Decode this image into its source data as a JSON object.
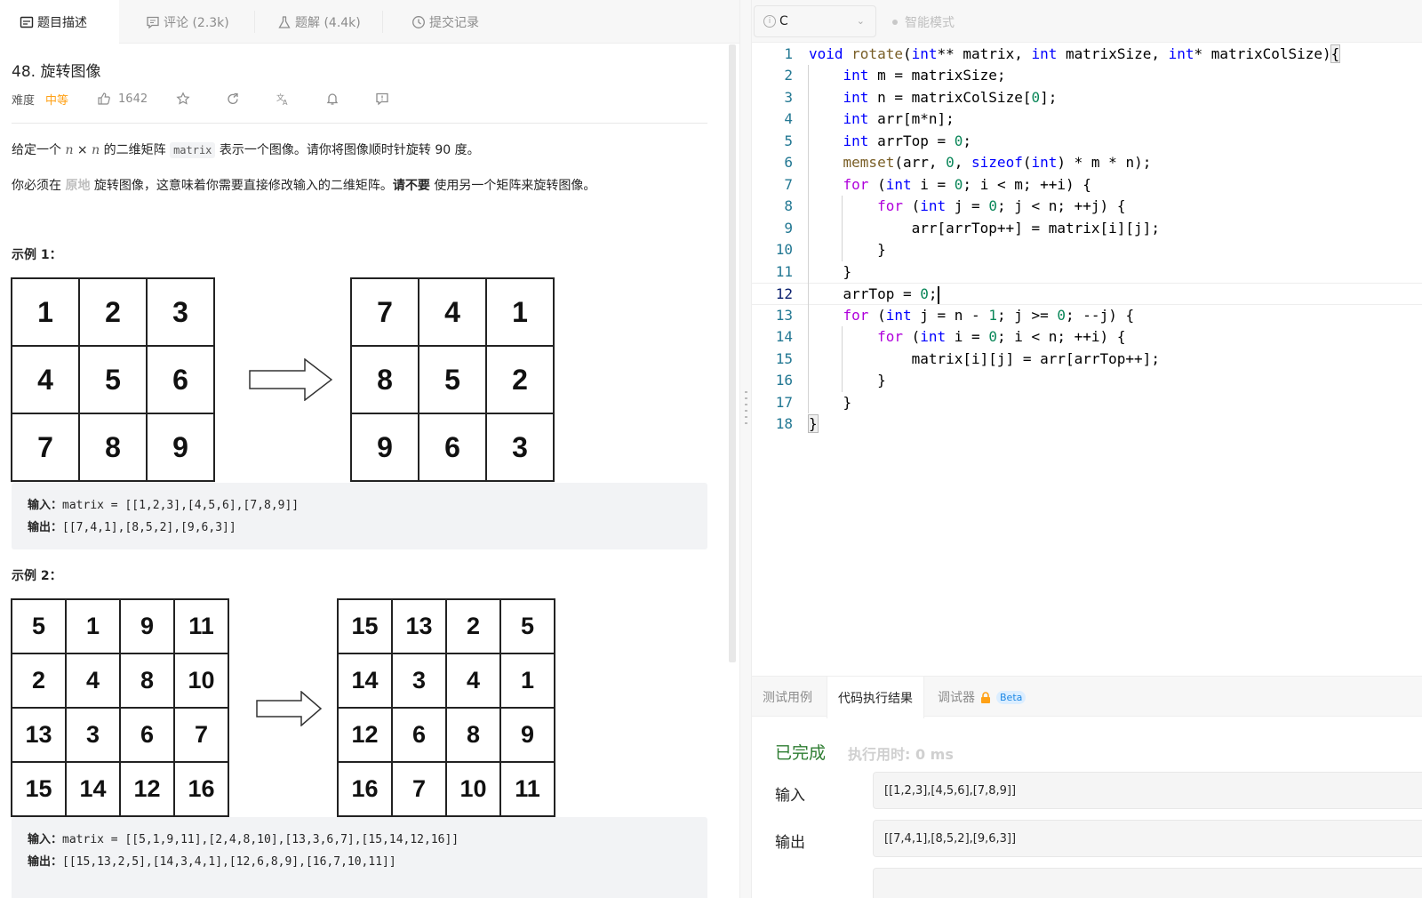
{
  "left_tabs": [
    {
      "label": "题目描述",
      "icon": "description-icon",
      "active": true
    },
    {
      "label": "评论 (2.3k)",
      "icon": "comment-icon",
      "active": false
    },
    {
      "label": "题解 (4.4k)",
      "icon": "flask-icon",
      "active": false
    },
    {
      "label": "提交记录",
      "icon": "clock-icon",
      "active": false
    }
  ],
  "problem": {
    "title": "48. 旋转图像",
    "difficulty_label": "难度",
    "difficulty_value": "中等",
    "likes": "1642",
    "desc1_a": "给定一个 ",
    "desc1_n1": "n",
    "desc1_x": " × ",
    "desc1_n2": "n",
    "desc1_b": " 的二维矩阵 ",
    "desc1_code": "matrix",
    "desc1_c": " 表示一个图像。请你将图像顺时针旋转 90 度。",
    "desc2_a": "你必须在 ",
    "desc2_inplace": "原地",
    "desc2_b": " 旋转图像，这意味着你需要直接修改输入的二维矩阵。",
    "desc2_bold": "请不要",
    "desc2_c": " 使用另一个矩阵来旋转图像。"
  },
  "examples": [
    {
      "heading": "示例 1：",
      "input_matrix": [
        [
          1,
          2,
          3
        ],
        [
          4,
          5,
          6
        ],
        [
          7,
          8,
          9
        ]
      ],
      "output_matrix": [
        [
          7,
          4,
          1
        ],
        [
          8,
          5,
          2
        ],
        [
          9,
          6,
          3
        ]
      ],
      "input_label": "输入：",
      "input_text": "matrix = [[1,2,3],[4,5,6],[7,8,9]]",
      "output_label": "输出：",
      "output_text": "[[7,4,1],[8,5,2],[9,6,3]]"
    },
    {
      "heading": "示例 2：",
      "input_matrix": [
        [
          5,
          1,
          9,
          11
        ],
        [
          2,
          4,
          8,
          10
        ],
        [
          13,
          3,
          6,
          7
        ],
        [
          15,
          14,
          12,
          16
        ]
      ],
      "output_matrix": [
        [
          15,
          13,
          2,
          5
        ],
        [
          14,
          3,
          4,
          1
        ],
        [
          12,
          6,
          8,
          9
        ],
        [
          16,
          7,
          10,
          11
        ]
      ],
      "input_label": "输入：",
      "input_text": "matrix = [[5,1,9,11],[2,4,8,10],[13,3,6,7],[15,14,12,16]]",
      "output_label": "输出：",
      "output_text": "[[15,13,2,5],[14,3,4,1],[12,6,8,9],[16,7,10,11]]"
    }
  ],
  "editor": {
    "language": "C",
    "smart_mode": "智能模式",
    "current_line": 12,
    "lines": [
      "void rotate(int** matrix, int matrixSize, int* matrixColSize){",
      "    int m = matrixSize;",
      "    int n = matrixColSize[0];",
      "    int arr[m*n];",
      "    int arrTop = 0;",
      "    memset(arr, 0, sizeof(int) * m * n);",
      "    for (int i = 0; i < m; ++i) {",
      "        for (int j = 0; j < n; ++j) {",
      "            arr[arrTop++] = matrix[i][j];",
      "        }",
      "    }",
      "    arrTop = 0;",
      "    for (int j = n - 1; j >= 0; --j) {",
      "        for (int i = 0; i < n; ++i) {",
      "            matrix[i][j] = arr[arrTop++];",
      "        }",
      "    }",
      "}"
    ]
  },
  "console": {
    "tabs": [
      {
        "label": "测试用例",
        "active": false
      },
      {
        "label": "代码执行结果",
        "active": true
      },
      {
        "label": "调试器",
        "active": false,
        "badge": "Beta"
      }
    ],
    "status": "已完成",
    "runtime": "执行用时: 0 ms",
    "input_label": "输入",
    "input_value": "[[1,2,3],[4,5,6],[7,8,9]]",
    "output_label": "输出",
    "output_value": "[[7,4,1],[8,5,2],[9,6,3]]"
  },
  "colors": {
    "difficulty": "#ffa116",
    "success": "#2e7d32",
    "keyword": "#0000ff",
    "control": "#af00db",
    "number": "#098658",
    "function": "#795e26",
    "line_number": "#237893"
  }
}
